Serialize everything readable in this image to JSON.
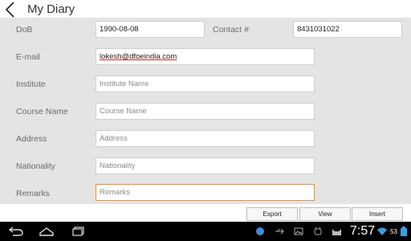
{
  "app": {
    "title": "My Diary"
  },
  "form": {
    "dob": {
      "label": "DoB",
      "value": "1990-08-08"
    },
    "contact": {
      "label": "Contact #",
      "value": "8431031022"
    },
    "email": {
      "label": "E-mail",
      "value": "lokesh@dfoeindia.com"
    },
    "institute": {
      "label": "Institute",
      "placeholder": "Institute Name"
    },
    "course": {
      "label": "Course Name",
      "placeholder": "Course Name"
    },
    "address": {
      "label": "Address",
      "placeholder": "Address"
    },
    "nationality": {
      "label": "Nationality",
      "placeholder": "Nationality"
    },
    "remarks": {
      "label": "Remarks",
      "placeholder": "Remarks"
    }
  },
  "buttons": {
    "export": "Export",
    "view": "View",
    "insert": "Insert"
  },
  "status": {
    "time": "7:57",
    "battery": "53"
  },
  "colors": {
    "focus": "#f0922a",
    "form_bg": "#e4e4e4",
    "navbar": "#000000"
  },
  "icons": [
    "back-icon",
    "home-icon",
    "recent-apps-icon",
    "android-robot-icon",
    "usb-icon",
    "image-icon",
    "bug-icon",
    "cat-icon",
    "wifi-icon",
    "battery-icon"
  ]
}
